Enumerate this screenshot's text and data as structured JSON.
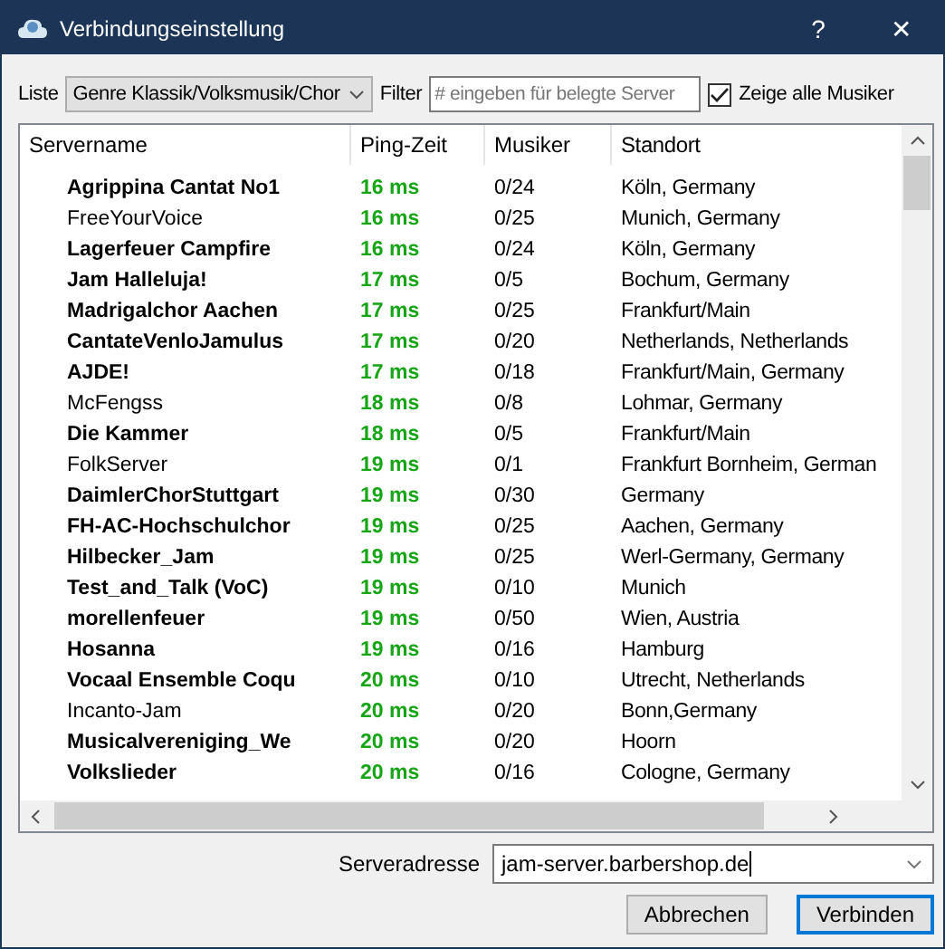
{
  "window": {
    "title": "Verbindungseinstellung",
    "help": "?",
    "close": "✕"
  },
  "toolbar": {
    "list_label": "Liste",
    "list_value": "Genre Klassik/Volksmusik/Chor",
    "filter_label": "Filter",
    "filter_placeholder": "# eingeben für belegte Server",
    "show_all": {
      "label": "Zeige alle Musiker",
      "checked": true
    }
  },
  "table": {
    "columns": [
      "Servername",
      "Ping-Zeit",
      "Musiker",
      "Standort"
    ],
    "rows": [
      {
        "name": "Agrippina Cantat No1",
        "bold": true,
        "ping": "16 ms",
        "musicians": "0/24",
        "location": "Köln, Germany"
      },
      {
        "name": "FreeYourVoice",
        "bold": false,
        "ping": "16 ms",
        "musicians": "0/25",
        "location": "Munich, Germany"
      },
      {
        "name": "Lagerfeuer Campfire",
        "bold": true,
        "ping": "16 ms",
        "musicians": "0/24",
        "location": "Köln, Germany"
      },
      {
        "name": "Jam Halleluja!",
        "bold": true,
        "ping": "17 ms",
        "musicians": "0/5",
        "location": "Bochum, Germany"
      },
      {
        "name": "Madrigalchor Aachen",
        "bold": true,
        "ping": "17 ms",
        "musicians": "0/25",
        "location": "Frankfurt/Main"
      },
      {
        "name": "CantateVenloJamulus",
        "bold": true,
        "ping": "17 ms",
        "musicians": "0/20",
        "location": "Netherlands, Netherlands"
      },
      {
        "name": "AJDE!",
        "bold": true,
        "ping": "17 ms",
        "musicians": "0/18",
        "location": "Frankfurt/Main, Germany"
      },
      {
        "name": "McFengss",
        "bold": false,
        "ping": "18 ms",
        "musicians": "0/8",
        "location": "Lohmar, Germany"
      },
      {
        "name": "Die Kammer",
        "bold": true,
        "ping": "18 ms",
        "musicians": "0/5",
        "location": "Frankfurt/Main"
      },
      {
        "name": "FolkServer",
        "bold": false,
        "ping": "19 ms",
        "musicians": "0/1",
        "location": "Frankfurt Bornheim, German"
      },
      {
        "name": "DaimlerChorStuttgart",
        "bold": true,
        "ping": "19 ms",
        "musicians": "0/30",
        "location": "Germany"
      },
      {
        "name": "FH-AC-Hochschulchor",
        "bold": true,
        "ping": "19 ms",
        "musicians": "0/25",
        "location": "Aachen, Germany"
      },
      {
        "name": "Hilbecker_Jam",
        "bold": true,
        "ping": "19 ms",
        "musicians": "0/25",
        "location": "Werl-Germany, Germany"
      },
      {
        "name": "Test_and_Talk (VoC)",
        "bold": true,
        "ping": "19 ms",
        "musicians": "0/10",
        "location": "Munich"
      },
      {
        "name": "morellenfeuer",
        "bold": true,
        "ping": "19 ms",
        "musicians": "0/50",
        "location": "Wien, Austria"
      },
      {
        "name": "Hosanna",
        "bold": true,
        "ping": "19 ms",
        "musicians": "0/16",
        "location": "Hamburg"
      },
      {
        "name": "Vocaal Ensemble Coqu",
        "bold": true,
        "ping": "20 ms",
        "musicians": "0/10",
        "location": "Utrecht, Netherlands"
      },
      {
        "name": "Incanto-Jam",
        "bold": false,
        "ping": "20 ms",
        "musicians": "0/20",
        "location": "Bonn,Germany"
      },
      {
        "name": "Musicalvereniging_We",
        "bold": true,
        "ping": "20 ms",
        "musicians": "0/20",
        "location": "Hoorn"
      },
      {
        "name": "Volkslieder",
        "bold": true,
        "ping": "20 ms",
        "musicians": "0/16",
        "location": "Cologne, Germany"
      }
    ]
  },
  "server_address": {
    "label": "Serveradresse",
    "value": "jam-server.barbershop.de"
  },
  "buttons": [
    {
      "label": "Abbrechen",
      "default": false
    },
    {
      "label": "Verbinden",
      "default": true
    }
  ]
}
